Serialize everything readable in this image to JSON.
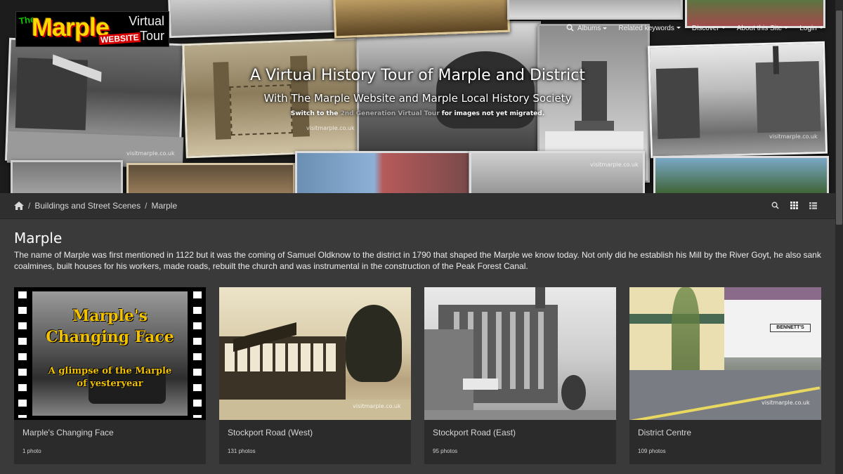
{
  "logo": {
    "the": "The",
    "marple": "Marple",
    "website": "WEBSITE",
    "line1": "Virtual",
    "line2": "Tour"
  },
  "nav": {
    "albums": "Albums",
    "keywords": "Related keywords",
    "discover": "Discover",
    "about": "About this Site",
    "login": "Login"
  },
  "hero": {
    "title": "A Virtual History Tour of Marple and District",
    "subtitle": "With The Marple Website and Marple Local History Society",
    "switch_prefix": "Switch to the ",
    "switch_link": "2nd Generation Virtual Tour",
    "switch_suffix": " for images not yet migrated.",
    "watermark": "visitmarple.co.uk"
  },
  "breadcrumb": {
    "level1": "Buildings and Street Scenes",
    "level2": "Marple"
  },
  "page": {
    "title": "Marple",
    "description": "The name of Marple was first mentioned in 1122 but it was the coming of Samuel Oldknow to the district in 1790 that shaped the Marple we know today. Not only did he establish his Mill by the River Goyt, he also sank coalmines, built houses for his workers, made roads, rebuilt the church and was instrumental in the construction of the Peak Forest Canal."
  },
  "albums": [
    {
      "name": "Marple's Changing Face",
      "count": "1 photo",
      "thumb_line1": "Marple's",
      "thumb_line2": "Changing Face",
      "thumb_line3": "A glimpse of the Marple",
      "thumb_line4": "of yesteryear"
    },
    {
      "name": "Stockport Road (West)",
      "count": "131 photos",
      "watermark": "visitmarple.co.uk"
    },
    {
      "name": "Stockport Road (East)",
      "count": "95 photos"
    },
    {
      "name": "District Centre",
      "count": "109 photos",
      "watermark": "visitmarple.co.uk",
      "sign": "BENNETT'S"
    }
  ],
  "colors": {
    "background": "#3a3a3a",
    "bar": "#2f2f2f",
    "card": "#2b2b2b",
    "link_muted": "#a9a9a9"
  }
}
